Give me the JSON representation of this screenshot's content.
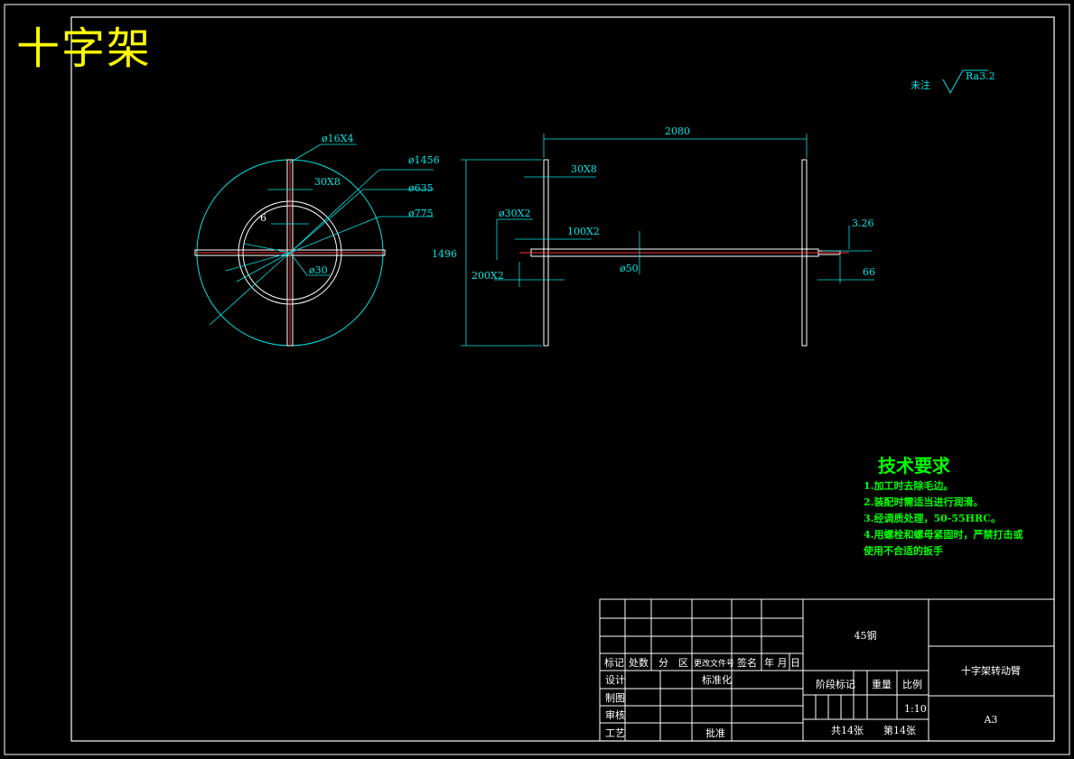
{
  "title": "十字架",
  "surface_note": {
    "label": "未注",
    "roughness": "Ra3.2"
  },
  "dimensions": {
    "front": {
      "hole": "ø16X4",
      "outer_dia": "ø1456",
      "d635": "ø635",
      "d775": "ø775",
      "width_30": "30X8",
      "width_6": "6",
      "center": "ø30"
    },
    "side": {
      "length": "2080",
      "plate_thk": "30X8",
      "shaft_end": "ø30X2",
      "collar": "100X2",
      "height": "1496",
      "pitch": "200X2",
      "shaft": "ø50",
      "chamfer": "3.26",
      "end_len": "66"
    }
  },
  "tech_requirements": {
    "title": "技术要求",
    "items": [
      "1.加工时去除毛边。",
      "2.装配时需适当进行润滑。",
      "3.经调质处理，50-55HRC。",
      "4.用螺栓和螺母紧固时，严禁打击或",
      "使用不合适的扳手"
    ]
  },
  "title_block": {
    "material": "45钢",
    "part_name": "十字架转动臂",
    "headers": {
      "mark": "标记",
      "count": "处数",
      "zone": "分　区",
      "doc": "更改文件号",
      "sign": "签名",
      "date": "年 月 日"
    },
    "rows": {
      "design": "设计",
      "std": "标准化",
      "draw": "制图",
      "check": "审核",
      "process": "工艺",
      "approve": "批准"
    },
    "stage_mark": "阶段标记",
    "weight": "重量",
    "scale_label": "比例",
    "scale": "1:10",
    "sheets": "共14张　　第14张",
    "size": "A3"
  }
}
